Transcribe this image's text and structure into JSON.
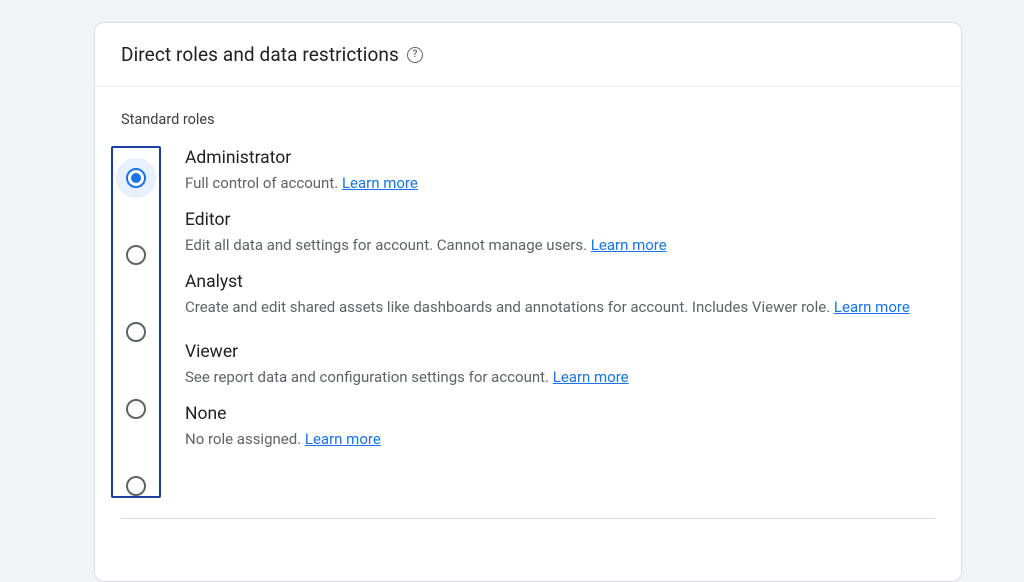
{
  "header": {
    "title": "Direct roles and data restrictions"
  },
  "section_label": "Standard roles",
  "learn_more": "Learn more",
  "roles": [
    {
      "name": "Administrator",
      "description": "Full control of account.",
      "selected": true
    },
    {
      "name": "Editor",
      "description": "Edit all data and settings for account. Cannot manage users.",
      "selected": false
    },
    {
      "name": "Analyst",
      "description": "Create and edit shared assets like dashboards and annotations for account. Includes Viewer role.",
      "selected": false
    },
    {
      "name": "Viewer",
      "description": "See report data and configuration settings for account.",
      "selected": false
    },
    {
      "name": "None",
      "description": "No role assigned.",
      "selected": false
    }
  ]
}
